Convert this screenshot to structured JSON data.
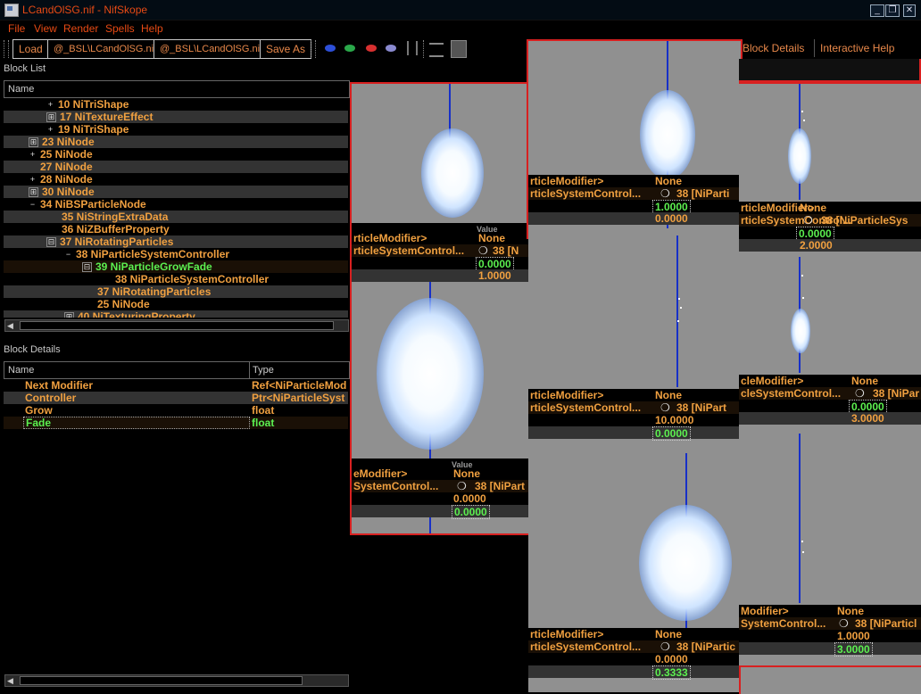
{
  "window": {
    "title": "LCandOlSG.nif - NifSkope",
    "buttons": [
      "_",
      "❐",
      "✕"
    ]
  },
  "menu": [
    "File",
    "View",
    "Render",
    "Spells",
    "Help"
  ],
  "toolbar": {
    "load": "Load",
    "file1": "@_BSL\\LCandOlSG.nif",
    "file2": "@_BSL\\LCandOlSG.nif",
    "save_as": "Save As",
    "block_details": "Block Details",
    "interactive_help": "Interactive Help",
    "eye_colors": [
      "#2d4fd8",
      "#2aa84a",
      "#d83030",
      "#8a8ad0"
    ]
  },
  "block_list": {
    "label": "Block List",
    "header": "Name",
    "rows": [
      {
        "exp": "+",
        "text": "10 NiTriShape"
      },
      {
        "exp": "⊞",
        "text": "17 NiTextureEffect"
      },
      {
        "exp": "+",
        "text": "19 NiTriShape"
      },
      {
        "exp": "⊞",
        "text": "23 NiNode"
      },
      {
        "exp": "+",
        "text": "25 NiNode"
      },
      {
        "exp": "",
        "text": "27 NiNode"
      },
      {
        "exp": "+",
        "text": "28 NiNode"
      },
      {
        "exp": "⊞",
        "text": "30 NiNode"
      },
      {
        "exp": "−",
        "text": "34 NiBSParticleNode"
      },
      {
        "exp": "",
        "text": "35 NiStringExtraData"
      },
      {
        "exp": "",
        "text": "36 NiZBufferProperty"
      },
      {
        "exp": "⊟",
        "text": "37 NiRotatingParticles"
      },
      {
        "exp": "−",
        "text": "38 NiParticleSystemController"
      },
      {
        "exp": "⊟",
        "text": "39 NiParticleGrowFade"
      },
      {
        "exp": "",
        "text": "38 NiParticleSystemController"
      },
      {
        "exp": "",
        "text": "37 NiRotatingParticles"
      },
      {
        "exp": "",
        "text": "25 NiNode"
      },
      {
        "exp": "⊞",
        "text": "40 NiTexturingProperty"
      }
    ]
  },
  "block_details": {
    "label": "Block Details",
    "col_name": "Name",
    "col_type": "Type",
    "rows": [
      {
        "name": "Next Modifier",
        "type": "Ref<NiParticleMod"
      },
      {
        "name": "Controller",
        "type": "Ptr<NiParticleSyst"
      },
      {
        "name": "Grow",
        "type": "float"
      },
      {
        "name": "Fade",
        "type": "float"
      }
    ]
  },
  "panes": {
    "p1": {
      "l1": "rticleModifier>",
      "l2": "rticleSystemControl...",
      "v1": "None",
      "v2": "38 [N",
      "v3": "0.0000",
      "v4": "1.0000"
    },
    "p2": {
      "l1": "rticleModifier>",
      "l2": "rticleSystemControl...",
      "v1": "None",
      "v2": "38 [NiParti",
      "v3": "1.0000",
      "v4": "0.0000"
    },
    "p3": {
      "l1": "rticleModifier>",
      "l2": "rticleSystemControl...",
      "v1": "None",
      "v2": "38 [NiParticleSys",
      "v3": "0.0000",
      "v4": "2.0000"
    },
    "p4": {
      "l1": "rticleModifier>",
      "l2": "rticleSystemControl...",
      "v1": "None",
      "v2": "38 [NiPart",
      "v3": "10.0000",
      "v4": "0.0000"
    },
    "p5": {
      "l1": "cleModifier>",
      "l2": "cleSystemControl...",
      "v1": "None",
      "v2": "38 [NiPar",
      "v3": "0.0000",
      "v4": "3.0000"
    },
    "p6": {
      "l1": "eModifier>",
      "l2": "SystemControl...",
      "v1": "None",
      "v2": "38 [NiPart",
      "v3": "0.0000",
      "v4": "0.0000",
      "head": "Value"
    },
    "p7": {
      "l1": "rticleModifier>",
      "l2": "rticleSystemControl...",
      "v1": "None",
      "v2": "38 [NiPartic",
      "v3": "0.0000",
      "v4": "0.3333"
    },
    "p8": {
      "l1": "Modifier>",
      "l2": "SystemControl...",
      "v1": "None",
      "v2": "38 [NiParticl",
      "v3": "1.0000",
      "v4": "3.0000"
    },
    "p1_head": "Value"
  }
}
